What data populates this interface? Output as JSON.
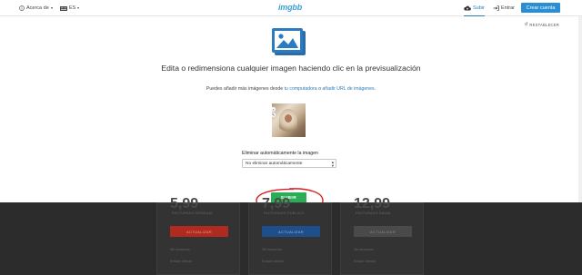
{
  "topbar": {
    "about_label": "Acerca de",
    "lang_label": "ES",
    "logo": "imgbb",
    "upload_label": "Subir",
    "login_label": "Entrar",
    "signup_label": "Crear cuenta"
  },
  "panel": {
    "reset_label": "RESTABLECER",
    "title": "Edita o redimensiona cualquier imagen haciendo clic en la previsualización",
    "subline_prefix": "Puedes añadir más imágenes desde ",
    "subline_link1": "tu computadora",
    "subline_mid": " o ",
    "subline_link2": "añadir URL de imágenes",
    "subline_suffix": ".",
    "auto_delete_label": "Eliminar automáticamente la imagen",
    "auto_delete_value": "No eliminar automáticamente",
    "upload_button": "SUBIR"
  },
  "colors": {
    "accent": "#2a8ed2",
    "upload_green": "#2aad55",
    "annotation_red": "#d8211f",
    "logo_blue": "#3ea1d6"
  },
  "pricing": {
    "cards": [
      {
        "price": "5,99",
        "billing": "FACTURADO MENSUAL",
        "action": "ACTUALIZAR",
        "action_color": "#b02a1f",
        "line1": "Sin anuncios",
        "line2": "Enlace directo"
      },
      {
        "price": "7,99",
        "billing": "FACTURADO PUBLICO",
        "action": "ACTUALIZAR",
        "action_color": "#1f4f8a",
        "line1": "Sin anuncios",
        "line2": "Enlace directo"
      },
      {
        "price": "12,99",
        "billing": "FACTURADO ANUAL",
        "action": "ACTUALIZAR",
        "action_color": "#4a4a4a",
        "line1": "Sin anuncios",
        "line2": "Enlace directo"
      }
    ]
  }
}
